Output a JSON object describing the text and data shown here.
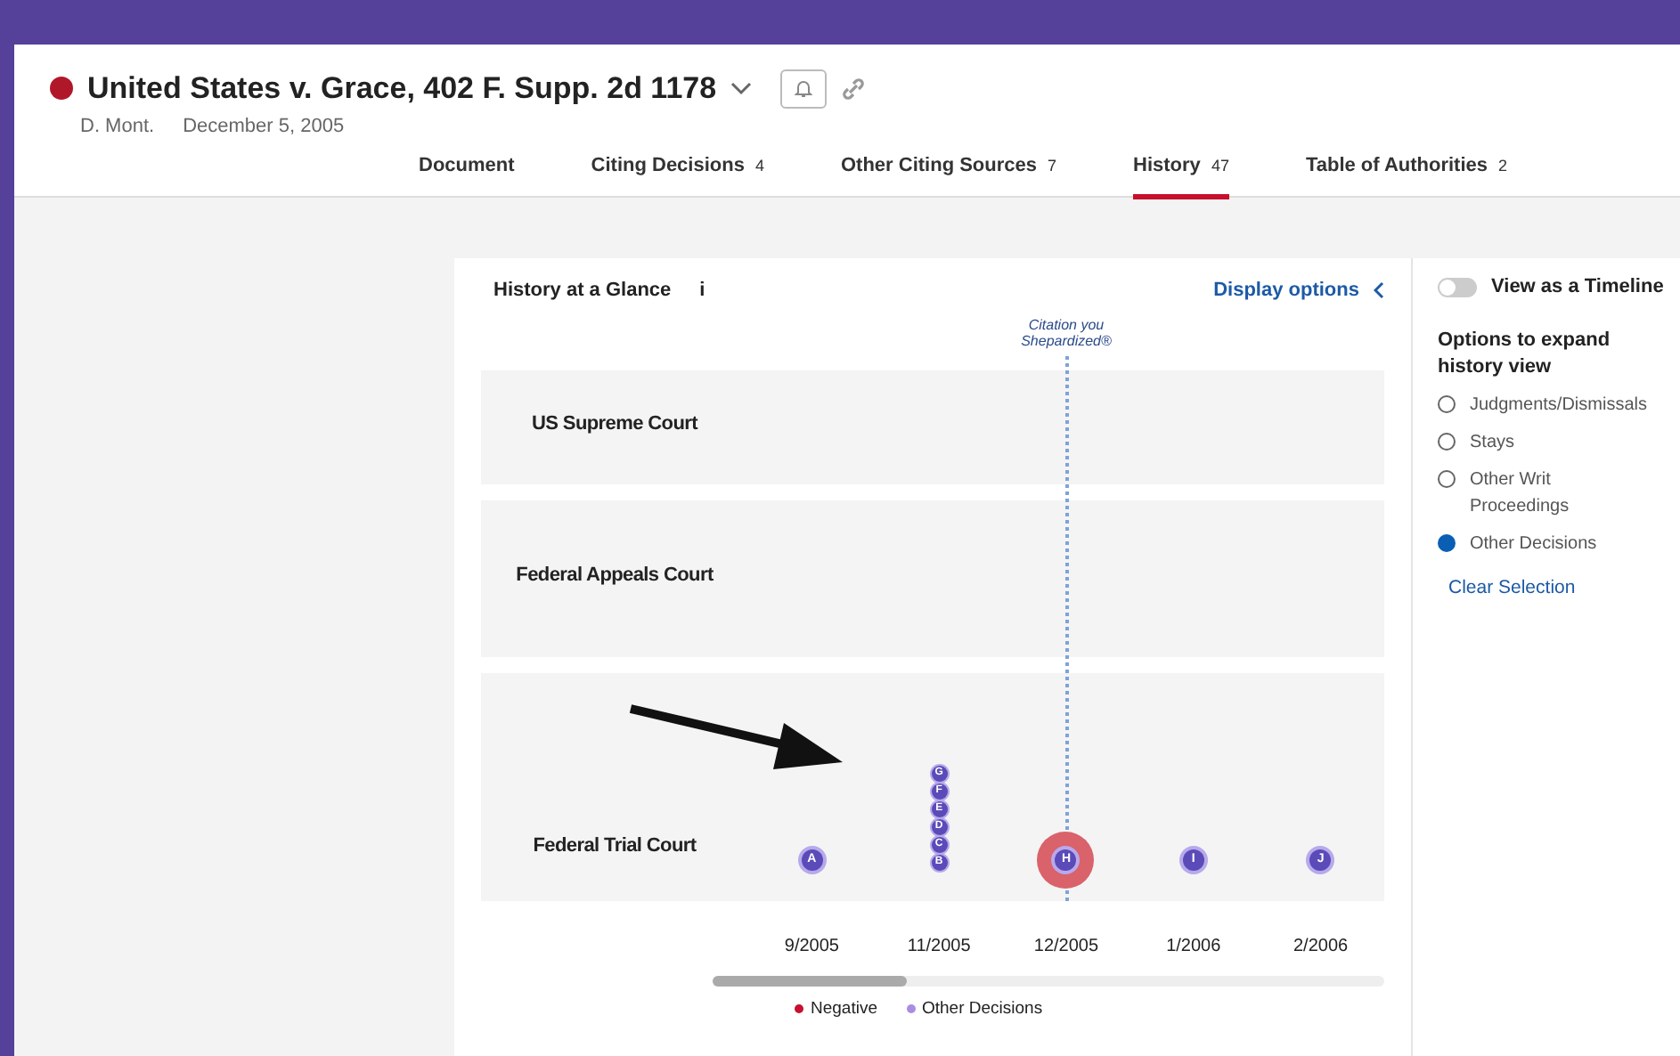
{
  "case": {
    "title": "United States v. Grace, 402 F. Supp. 2d 1178",
    "court": "D. Mont.",
    "date": "December 5, 2005"
  },
  "tabs": [
    {
      "label": "Document",
      "selected": false
    },
    {
      "label": "Citing Decisions",
      "count": "4",
      "selected": false
    },
    {
      "label": "Other Citing Sources",
      "count": "7",
      "selected": false
    },
    {
      "label": "History",
      "count": "47",
      "selected": true
    },
    {
      "label": "Table of Authorities",
      "count": "2",
      "selected": false
    }
  ],
  "history": {
    "title": "History at a Glance",
    "info": "i",
    "display_options": "Display options",
    "citation_label": "Citation you",
    "citation_label_2": "Shepardized®",
    "dates": [
      {
        "label": "9/2005",
        "shepardized": false
      },
      {
        "label": "11/2005",
        "shepardized": false
      },
      {
        "label": "12/2005",
        "shepardized": true
      },
      {
        "label": "1/2006",
        "shepardized": false
      },
      {
        "label": "2/2006",
        "shepardized": false
      }
    ],
    "courts": [
      {
        "label": "US Supreme Court"
      },
      {
        "label": "Federal Appeals Court"
      },
      {
        "label": "Federal Trial Court",
        "date_groups": [
          {
            "markers": [
              {
                "label": "A",
                "kind": "other"
              }
            ]
          },
          {
            "markers": [
              {
                "label": "G",
                "kind": "other"
              },
              {
                "label": "F",
                "kind": "other"
              },
              {
                "label": "E",
                "kind": "other"
              },
              {
                "label": "D",
                "kind": "other"
              },
              {
                "label": "C",
                "kind": "other"
              },
              {
                "label": "B",
                "kind": "other"
              }
            ]
          },
          {
            "markers": [
              {
                "label": "H",
                "kind": "negative"
              }
            ]
          },
          {
            "markers": [
              {
                "label": "I",
                "kind": "other"
              }
            ]
          },
          {
            "markers": [
              {
                "label": "J",
                "kind": "other"
              }
            ]
          }
        ]
      }
    ],
    "legend": [
      {
        "label": "Negative",
        "color": "#c8102e"
      },
      {
        "label": "Other Decisions",
        "color": "#a98ee0"
      }
    ]
  },
  "options": {
    "timeline_toggle": {
      "label": "View as a Timeline",
      "on": false
    },
    "title": "Options to expand history view",
    "items": [
      {
        "label": "Judgments/Dismissals",
        "selected": false
      },
      {
        "label": "Stays",
        "selected": false
      },
      {
        "label": "Other Writ Proceedings",
        "selected": false
      },
      {
        "label": "Other Decisions",
        "selected": true
      }
    ],
    "clear": "Clear Selection"
  }
}
